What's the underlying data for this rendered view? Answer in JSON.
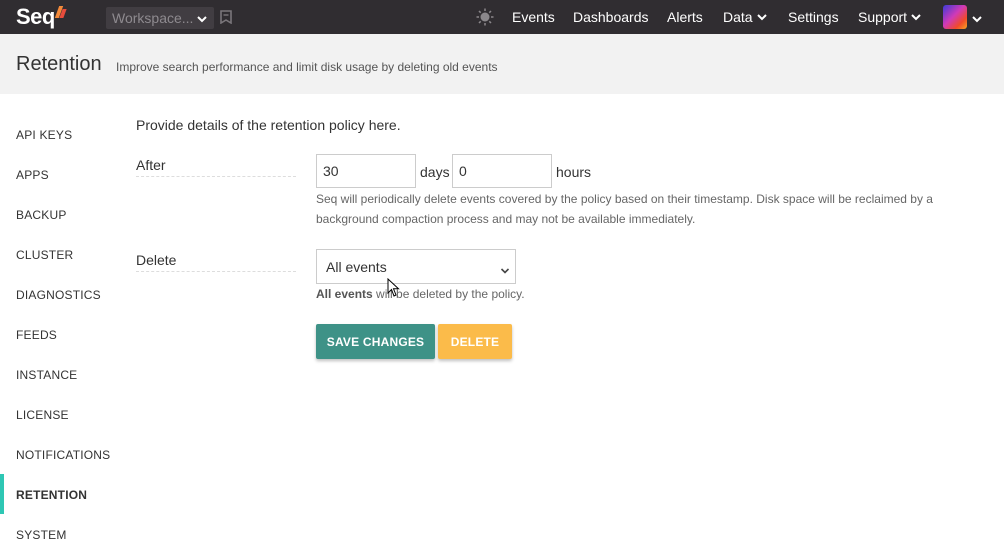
{
  "app": {
    "logo_text": "Seq"
  },
  "topbar": {
    "workspace_label": "Workspace...",
    "nav": {
      "events": "Events",
      "dashboards": "Dashboards",
      "alerts": "Alerts",
      "data": "Data",
      "settings": "Settings",
      "support": "Support"
    }
  },
  "header": {
    "title": "Retention",
    "subtitle": "Improve search performance and limit disk usage by deleting old events"
  },
  "sidebar": {
    "items": [
      {
        "label": "API KEYS"
      },
      {
        "label": "APPS"
      },
      {
        "label": "BACKUP"
      },
      {
        "label": "CLUSTER"
      },
      {
        "label": "DIAGNOSTICS"
      },
      {
        "label": "FEEDS"
      },
      {
        "label": "INSTANCE"
      },
      {
        "label": "LICENSE"
      },
      {
        "label": "NOTIFICATIONS"
      },
      {
        "label": "RETENTION"
      },
      {
        "label": "SYSTEM"
      }
    ],
    "active": "RETENTION"
  },
  "main": {
    "intro": "Provide details of the retention policy here.",
    "after": {
      "label": "After",
      "days_value": "30",
      "days_unit": "days",
      "hours_value": "0",
      "hours_unit": "hours",
      "help": "Seq will periodically delete events covered by the policy based on their timestamp. Disk space will be reclaimed by a background compaction process and may not be available immediately."
    },
    "delete": {
      "label": "Delete",
      "selected": "All events",
      "help_strong": "All events",
      "help_rest": " will be deleted by the policy."
    },
    "buttons": {
      "save": "SAVE CHANGES",
      "delete": "DELETE"
    }
  },
  "colors": {
    "topbar": "#302d31",
    "accent": "#2ec7b4",
    "save_button": "#3e9287",
    "delete_button": "#fbbb4a"
  }
}
